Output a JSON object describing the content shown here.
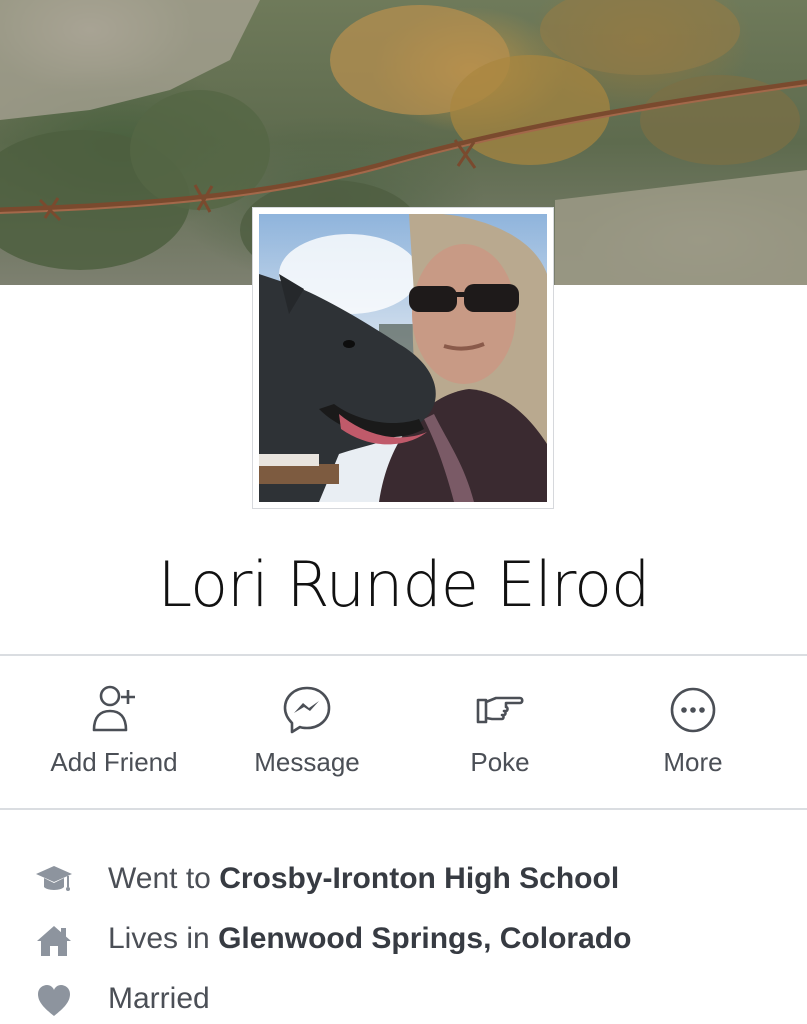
{
  "profile": {
    "name": "Lori Runde Elrod"
  },
  "actions": [
    {
      "label": "Add Friend",
      "icon": "add-friend-icon"
    },
    {
      "label": "Message",
      "icon": "messenger-icon"
    },
    {
      "label": "Poke",
      "icon": "poke-hand-icon"
    },
    {
      "label": "More",
      "icon": "more-dots-icon"
    }
  ],
  "intro": {
    "education": {
      "prefix": "Went to",
      "value": "Crosby-Ironton High School",
      "icon": "graduation-cap-icon"
    },
    "residence": {
      "prefix": "Lives in",
      "value": "Glenwood Springs, Colorado",
      "icon": "home-icon"
    },
    "relationship": {
      "value": "Married",
      "icon": "heart-icon"
    }
  },
  "colors": {
    "icon_gray": "#4b4f56",
    "divider": "#dadde1",
    "info_icon": "#8d949e"
  }
}
